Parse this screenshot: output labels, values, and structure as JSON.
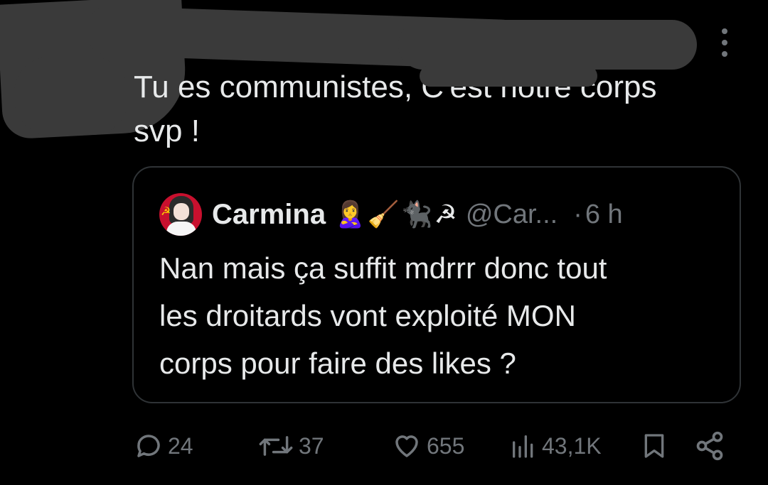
{
  "tweet": {
    "text_line1": "Tu es communistes, C'est notre corps",
    "text_line2": "svp !",
    "more_icon": "more-vertical-icon"
  },
  "quote": {
    "display_name": "Carmina",
    "name_emojis": "🙎‍♀️🧹🐈‍⬛☭",
    "handle": "@Car...",
    "separator": "·",
    "time": "6 h",
    "text_line1": "Nan mais ça suffit mdrrr donc tout",
    "text_line2": "les droitards vont exploité MON",
    "text_line3": "corps pour faire des likes ?"
  },
  "actions": {
    "replies": "24",
    "reposts": "37",
    "likes": "655",
    "views": "43,1K"
  },
  "colors": {
    "background": "#000000",
    "text": "#e7e9ea",
    "muted": "#71767b",
    "border": "#2f3336",
    "redaction": "#3a3a3a"
  }
}
